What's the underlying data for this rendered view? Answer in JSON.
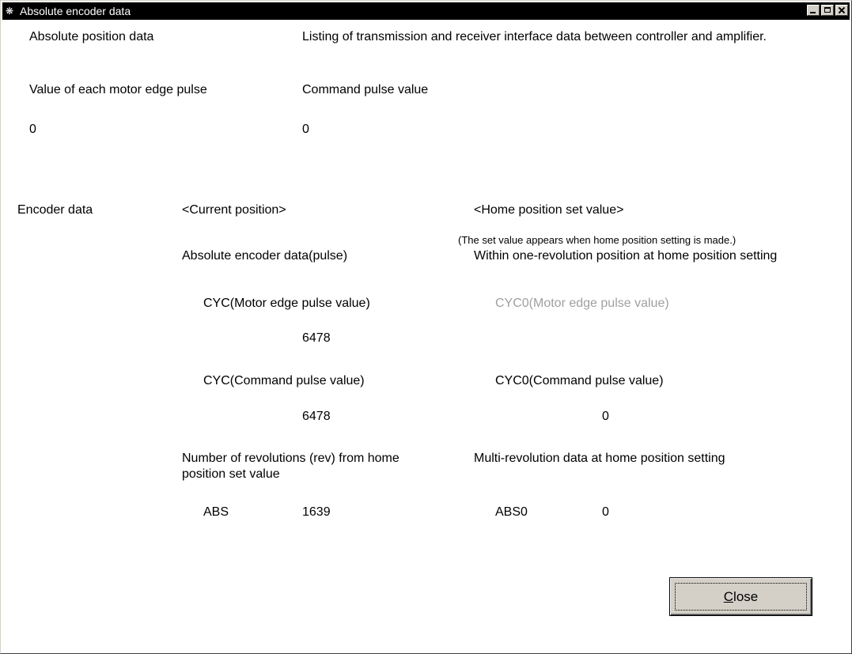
{
  "window": {
    "title": "Absolute encoder data"
  },
  "top": {
    "abs_position_label": "Absolute position data",
    "listing_description": "Listing of transmission and receiver interface data between controller and amplifier.",
    "motor_edge_pulse_label": "Value of each motor edge pulse",
    "command_pulse_label": "Command pulse value",
    "motor_edge_pulse_value": "0",
    "command_pulse_value": "0"
  },
  "encoder": {
    "section_label": "Encoder data",
    "current_position_header": "<Current position>",
    "home_position_header": "<Home position set value>",
    "home_note": "(The set value appears when home position setting is made.)",
    "abs_encoder_data_label": "Absolute encoder data(pulse)",
    "within_one_rev_label": "Within one-revolution position at home position setting",
    "cyc_motor_label": "CYC(Motor edge pulse value)",
    "cyc_motor_value": "6478",
    "cyc0_motor_label": "CYC0(Motor edge pulse value)",
    "cyc_command_label": "CYC(Command pulse value)",
    "cyc_command_value": "6478",
    "cyc0_command_label": "CYC0(Command pulse value)",
    "cyc0_command_value": "0",
    "revolutions_label": "Number of revolutions (rev) from home position set value",
    "multi_rev_label": "Multi-revolution data at home position setting",
    "abs_label": "ABS",
    "abs_value": "1639",
    "abs0_label": "ABS0",
    "abs0_value": "0"
  },
  "buttons": {
    "close_mnemonic": "C",
    "close_rest": "lose"
  },
  "icons": {
    "app": "app-icon",
    "minimize": "minimize-icon",
    "maximize": "maximize-icon",
    "close": "close-icon"
  },
  "colors": {
    "titlebar": "#000000",
    "background": "#ffffff",
    "disabled_text": "#a0a0a0",
    "button_face": "#d4d0c8"
  }
}
